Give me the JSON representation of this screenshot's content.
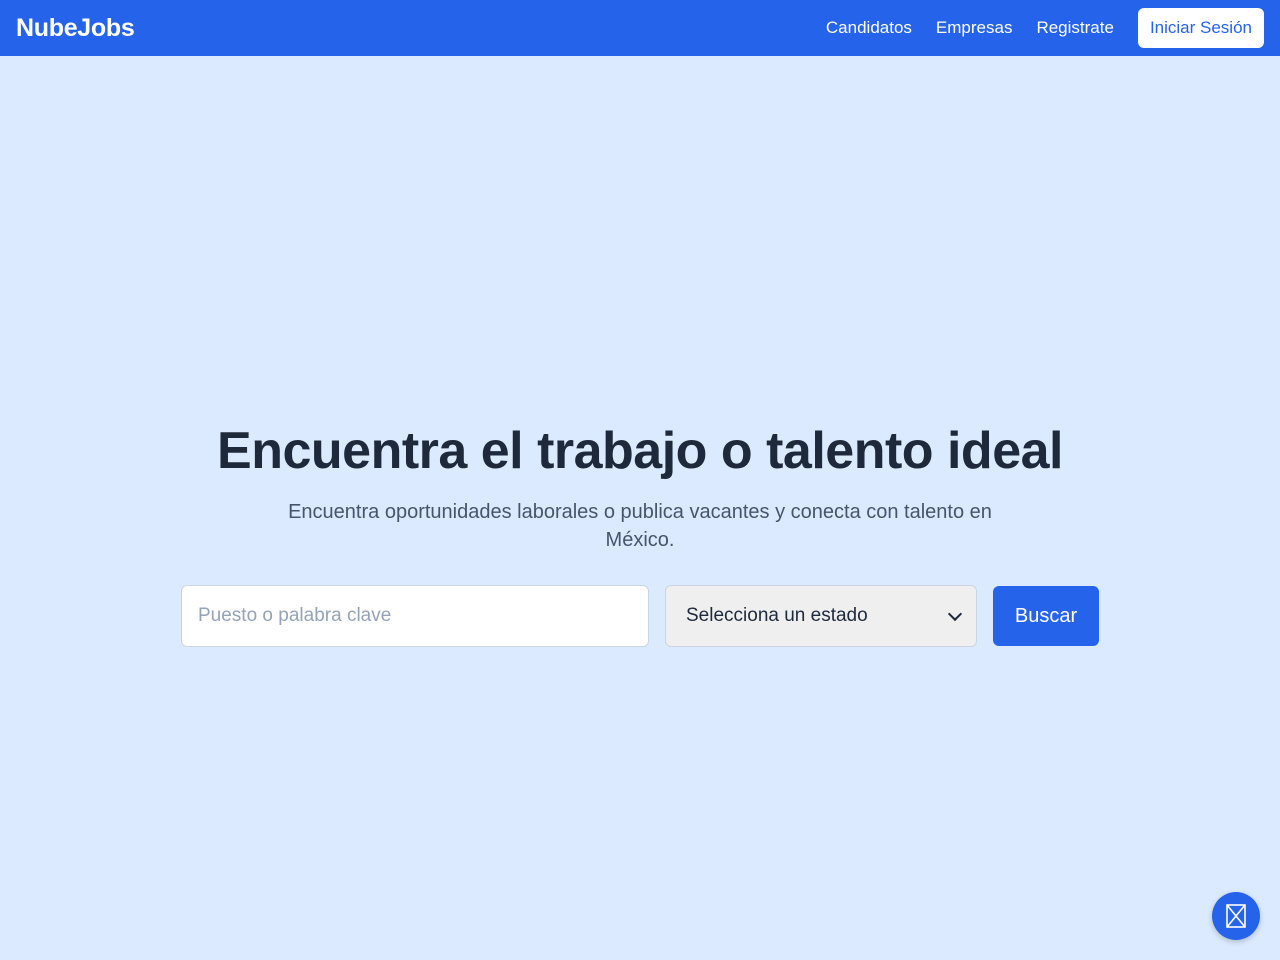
{
  "navbar": {
    "brand": "NubeJobs",
    "links": [
      {
        "label": "Candidatos"
      },
      {
        "label": "Empresas"
      },
      {
        "label": "Registrate"
      }
    ],
    "login_label": "Iniciar Sesión"
  },
  "hero": {
    "title": "Encuentra el trabajo o talento ideal",
    "subtitle": "Encuentra oportunidades laborales o publica vacantes y conecta con talento en México."
  },
  "search": {
    "keyword_placeholder": "Puesto o palabra clave",
    "state_selected": "Selecciona un estado",
    "button_label": "Buscar"
  },
  "floating_action": {
    "icon": "hourglass-icon"
  },
  "colors": {
    "primary": "#2563eb",
    "background": "#dbeafe",
    "text": "#1e293b",
    "muted_text": "#475569"
  }
}
